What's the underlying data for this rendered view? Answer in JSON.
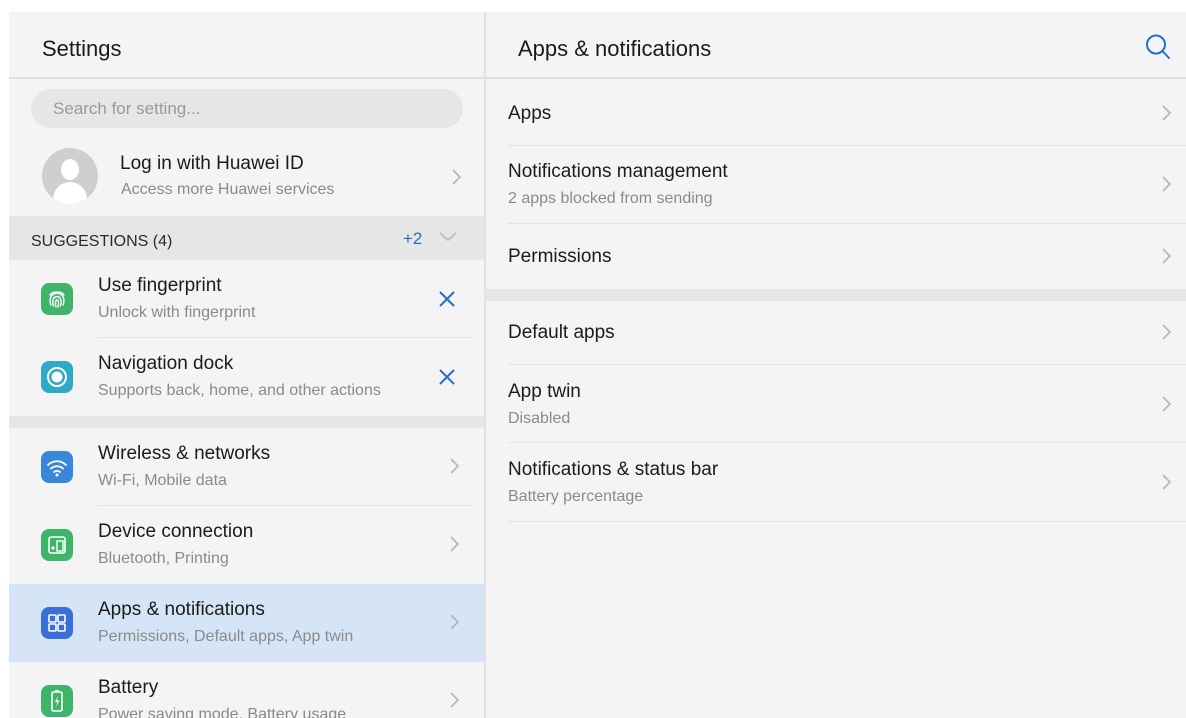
{
  "left": {
    "title": "Settings",
    "search_placeholder": "Search for setting...",
    "login": {
      "title": "Log in with Huawei ID",
      "subtitle": "Access more Huawei services"
    },
    "suggestions": {
      "label": "SUGGESTIONS (4)",
      "more": "+2",
      "items": [
        {
          "title": "Use fingerprint",
          "subtitle": "Unlock with fingerprint",
          "icon": "fingerprint-icon",
          "color": "#3fb56b"
        },
        {
          "title": "Navigation dock",
          "subtitle": "Supports back, home, and other actions",
          "icon": "navigation-dock-icon",
          "color": "#2fa9c6"
        }
      ]
    },
    "items": [
      {
        "title": "Wireless & networks",
        "subtitle": "Wi-Fi, Mobile data",
        "icon": "wifi-icon",
        "color": "#3a86d8"
      },
      {
        "title": "Device connection",
        "subtitle": "Bluetooth, Printing",
        "icon": "device-connection-icon",
        "color": "#3fb56b"
      },
      {
        "title": "Apps & notifications",
        "subtitle": "Permissions, Default apps, App twin",
        "icon": "apps-icon",
        "color": "#3a6fd8",
        "selected": true
      },
      {
        "title": "Battery",
        "subtitle": "Power saving mode, Battery usage",
        "icon": "battery-icon",
        "color": "#3fb56b"
      }
    ]
  },
  "right": {
    "title": "Apps & notifications",
    "items": [
      {
        "title": "Apps",
        "subtitle": ""
      },
      {
        "title": "Notifications management",
        "subtitle": "2 apps blocked from sending"
      },
      {
        "title": "Permissions",
        "subtitle": ""
      },
      {
        "title": "Default apps",
        "subtitle": ""
      },
      {
        "title": "App twin",
        "subtitle": "Disabled"
      },
      {
        "title": "Notifications & status bar",
        "subtitle": "Battery percentage"
      }
    ]
  },
  "colors": {
    "accent": "#2470c9",
    "selected_bg": "#d5e5f6",
    "background": "#f4f4f4"
  }
}
